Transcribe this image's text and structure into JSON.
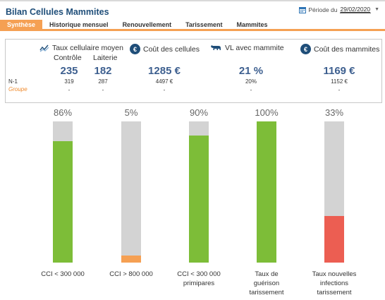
{
  "app_title": "Bilan Cellules Mammites",
  "period": {
    "label": "Période du",
    "date": "29/02/2020"
  },
  "tabs": [
    "Synthèse",
    "Historique mensuel",
    "Renouvellement",
    "Tarissement",
    "Mammites"
  ],
  "active_tab": "Synthèse",
  "kpis": {
    "row_labels": {
      "previous": "N-1",
      "group": "Groupe"
    },
    "taux_cellulaire": {
      "title": "Taux cellulaire moyen",
      "sub_labels": [
        "Contrôle",
        "Laiterie"
      ],
      "values": [
        "235",
        "182"
      ],
      "previous": [
        "319",
        "287"
      ],
      "group": [
        "-",
        "-"
      ]
    },
    "cout_cellules": {
      "title": "Coût des cellules",
      "value": "1285 €",
      "previous": "4497 €",
      "group": "-"
    },
    "vl_mammite": {
      "title": "VL avec mammite",
      "value": "21 %",
      "previous": "20%",
      "group": "-"
    },
    "cout_mammites": {
      "title": "Coût des mammites",
      "value": "1169 €",
      "previous": "1152 €",
      "group": "-"
    }
  },
  "colors": {
    "accent": "#f5a053",
    "title": "#1f4e79",
    "kpi_value": "#3d5f8f",
    "green": "#7dbd38",
    "orange": "#f5a053",
    "red": "#ec5e52",
    "grey": "#d3d3d3"
  },
  "chart_data": {
    "type": "bar",
    "categories": [
      "CCI < 300 000",
      "CCI > 800 000",
      "CCI < 300 000 primipares",
      "Taux de guérison tarissement",
      "Taux nouvelles infections tarissement"
    ],
    "category_lines": [
      [
        "CCI < 300 000"
      ],
      [
        "CCI > 800 000"
      ],
      [
        "CCI < 300 000",
        "primipares"
      ],
      [
        "Taux de",
        "guérison",
        "tarissement"
      ],
      [
        "Taux nouvelles",
        "infections",
        "tarissement"
      ]
    ],
    "values": [
      86,
      5,
      90,
      100,
      33
    ],
    "value_labels": [
      "86%",
      "5%",
      "90%",
      "100%",
      "33%"
    ],
    "bar_colors": [
      "#7dbd38",
      "#f5a053",
      "#7dbd38",
      "#7dbd38",
      "#ec5e52"
    ],
    "ylim": [
      0,
      100
    ],
    "background_color": "#d3d3d3"
  }
}
